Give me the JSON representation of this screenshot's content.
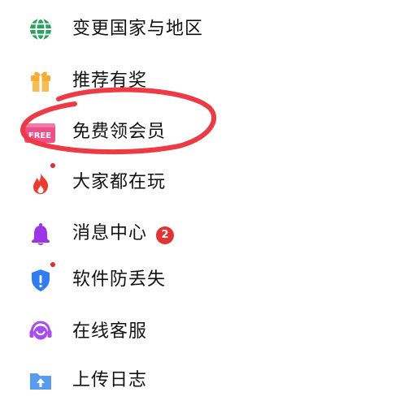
{
  "menu": {
    "items": [
      {
        "label": "变更国家与地区",
        "icon": "globe-icon"
      },
      {
        "label": "推荐有奖",
        "icon": "gift-icon"
      },
      {
        "label": "免费领会员",
        "icon": "free-ticket-icon",
        "icon_text": "FREE"
      },
      {
        "label": "大家都在玩",
        "icon": "flame-icon"
      },
      {
        "label": "消息中心",
        "icon": "bell-icon",
        "badge": "2"
      },
      {
        "label": "软件防丢失",
        "icon": "shield-icon"
      },
      {
        "label": "在线客服",
        "icon": "headset-icon"
      },
      {
        "label": "上传日志",
        "icon": "upload-folder-icon"
      }
    ]
  },
  "colors": {
    "globe": "#27a25a",
    "gift": "#f6ad34",
    "free_ticket": "#ee4f87",
    "flame": "#ee3a2c",
    "bell": "#9b35e6",
    "shield": "#2f7cf6",
    "headset": "#a84bf0",
    "folder": "#5a9bf2",
    "notification_dot": "#e12b2b",
    "badge": "#e53232",
    "scribble": "#ee3a45"
  }
}
